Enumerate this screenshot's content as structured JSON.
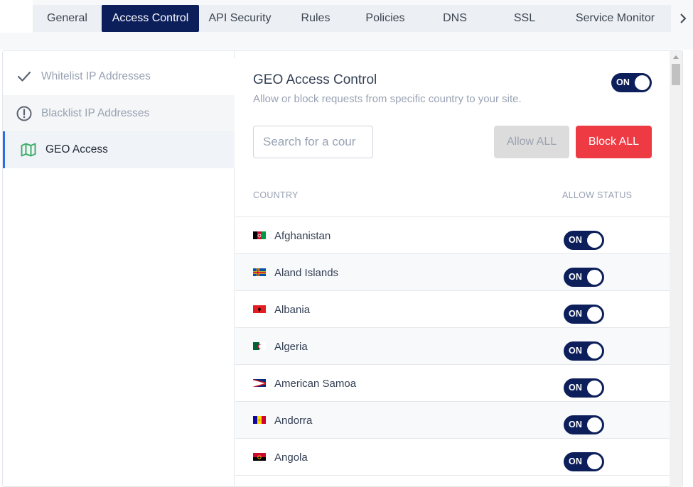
{
  "tabs": [
    {
      "label": "General",
      "active": false
    },
    {
      "label": "Access Control",
      "active": true
    },
    {
      "label": "API Security",
      "active": false
    },
    {
      "label": "Rules",
      "active": false
    },
    {
      "label": "Policies",
      "active": false
    },
    {
      "label": "DNS",
      "active": false
    },
    {
      "label": "SSL",
      "active": false
    },
    {
      "label": "Service Monitor",
      "active": false
    }
  ],
  "sidebar": {
    "items": [
      {
        "label": "Whitelist IP Addresses",
        "icon": "check-icon",
        "active": false
      },
      {
        "label": "Blacklist IP Addresses",
        "icon": "alert-circle-icon",
        "active": false
      },
      {
        "label": "GEO Access",
        "icon": "map-icon",
        "active": true
      }
    ]
  },
  "geo": {
    "title": "GEO Access Control",
    "subtitle": "Allow or block requests from specific country to your site.",
    "toggle_label": "ON",
    "search_placeholder": "Search for a country",
    "search_visible_text": "Search for a cour",
    "allow_all_label": "Allow ALL",
    "block_all_label": "Block ALL"
  },
  "table": {
    "headers": {
      "country": "COUNTRY",
      "status": "ALLOW STATUS"
    },
    "rows": [
      {
        "country": "Afghanistan",
        "status": "ON"
      },
      {
        "country": "Aland Islands",
        "status": "ON"
      },
      {
        "country": "Albania",
        "status": "ON"
      },
      {
        "country": "Algeria",
        "status": "ON"
      },
      {
        "country": "American Samoa",
        "status": "ON"
      },
      {
        "country": "Andorra",
        "status": "ON"
      },
      {
        "country": "Angola",
        "status": "ON"
      }
    ]
  },
  "colors": {
    "accent": "#0c1f5b",
    "danger": "#ee3b43",
    "active_indicator": "#2b6fe8",
    "map_icon": "#3fae6b"
  }
}
